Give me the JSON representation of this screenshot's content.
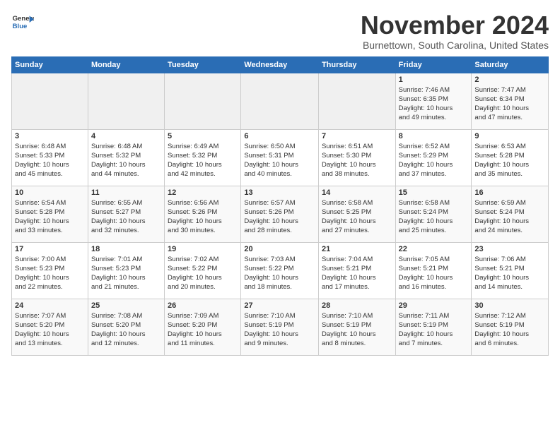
{
  "header": {
    "logo_general": "General",
    "logo_blue": "Blue",
    "month": "November 2024",
    "location": "Burnettown, South Carolina, United States"
  },
  "calendar": {
    "days_of_week": [
      "Sunday",
      "Monday",
      "Tuesday",
      "Wednesday",
      "Thursday",
      "Friday",
      "Saturday"
    ],
    "weeks": [
      [
        {
          "day": "",
          "info": ""
        },
        {
          "day": "",
          "info": ""
        },
        {
          "day": "",
          "info": ""
        },
        {
          "day": "",
          "info": ""
        },
        {
          "day": "",
          "info": ""
        },
        {
          "day": "1",
          "info": "Sunrise: 7:46 AM\nSunset: 6:35 PM\nDaylight: 10 hours\nand 49 minutes."
        },
        {
          "day": "2",
          "info": "Sunrise: 7:47 AM\nSunset: 6:34 PM\nDaylight: 10 hours\nand 47 minutes."
        }
      ],
      [
        {
          "day": "3",
          "info": "Sunrise: 6:48 AM\nSunset: 5:33 PM\nDaylight: 10 hours\nand 45 minutes."
        },
        {
          "day": "4",
          "info": "Sunrise: 6:48 AM\nSunset: 5:32 PM\nDaylight: 10 hours\nand 44 minutes."
        },
        {
          "day": "5",
          "info": "Sunrise: 6:49 AM\nSunset: 5:32 PM\nDaylight: 10 hours\nand 42 minutes."
        },
        {
          "day": "6",
          "info": "Sunrise: 6:50 AM\nSunset: 5:31 PM\nDaylight: 10 hours\nand 40 minutes."
        },
        {
          "day": "7",
          "info": "Sunrise: 6:51 AM\nSunset: 5:30 PM\nDaylight: 10 hours\nand 38 minutes."
        },
        {
          "day": "8",
          "info": "Sunrise: 6:52 AM\nSunset: 5:29 PM\nDaylight: 10 hours\nand 37 minutes."
        },
        {
          "day": "9",
          "info": "Sunrise: 6:53 AM\nSunset: 5:28 PM\nDaylight: 10 hours\nand 35 minutes."
        }
      ],
      [
        {
          "day": "10",
          "info": "Sunrise: 6:54 AM\nSunset: 5:28 PM\nDaylight: 10 hours\nand 33 minutes."
        },
        {
          "day": "11",
          "info": "Sunrise: 6:55 AM\nSunset: 5:27 PM\nDaylight: 10 hours\nand 32 minutes."
        },
        {
          "day": "12",
          "info": "Sunrise: 6:56 AM\nSunset: 5:26 PM\nDaylight: 10 hours\nand 30 minutes."
        },
        {
          "day": "13",
          "info": "Sunrise: 6:57 AM\nSunset: 5:26 PM\nDaylight: 10 hours\nand 28 minutes."
        },
        {
          "day": "14",
          "info": "Sunrise: 6:58 AM\nSunset: 5:25 PM\nDaylight: 10 hours\nand 27 minutes."
        },
        {
          "day": "15",
          "info": "Sunrise: 6:58 AM\nSunset: 5:24 PM\nDaylight: 10 hours\nand 25 minutes."
        },
        {
          "day": "16",
          "info": "Sunrise: 6:59 AM\nSunset: 5:24 PM\nDaylight: 10 hours\nand 24 minutes."
        }
      ],
      [
        {
          "day": "17",
          "info": "Sunrise: 7:00 AM\nSunset: 5:23 PM\nDaylight: 10 hours\nand 22 minutes."
        },
        {
          "day": "18",
          "info": "Sunrise: 7:01 AM\nSunset: 5:23 PM\nDaylight: 10 hours\nand 21 minutes."
        },
        {
          "day": "19",
          "info": "Sunrise: 7:02 AM\nSunset: 5:22 PM\nDaylight: 10 hours\nand 20 minutes."
        },
        {
          "day": "20",
          "info": "Sunrise: 7:03 AM\nSunset: 5:22 PM\nDaylight: 10 hours\nand 18 minutes."
        },
        {
          "day": "21",
          "info": "Sunrise: 7:04 AM\nSunset: 5:21 PM\nDaylight: 10 hours\nand 17 minutes."
        },
        {
          "day": "22",
          "info": "Sunrise: 7:05 AM\nSunset: 5:21 PM\nDaylight: 10 hours\nand 16 minutes."
        },
        {
          "day": "23",
          "info": "Sunrise: 7:06 AM\nSunset: 5:21 PM\nDaylight: 10 hours\nand 14 minutes."
        }
      ],
      [
        {
          "day": "24",
          "info": "Sunrise: 7:07 AM\nSunset: 5:20 PM\nDaylight: 10 hours\nand 13 minutes."
        },
        {
          "day": "25",
          "info": "Sunrise: 7:08 AM\nSunset: 5:20 PM\nDaylight: 10 hours\nand 12 minutes."
        },
        {
          "day": "26",
          "info": "Sunrise: 7:09 AM\nSunset: 5:20 PM\nDaylight: 10 hours\nand 11 minutes."
        },
        {
          "day": "27",
          "info": "Sunrise: 7:10 AM\nSunset: 5:19 PM\nDaylight: 10 hours\nand 9 minutes."
        },
        {
          "day": "28",
          "info": "Sunrise: 7:10 AM\nSunset: 5:19 PM\nDaylight: 10 hours\nand 8 minutes."
        },
        {
          "day": "29",
          "info": "Sunrise: 7:11 AM\nSunset: 5:19 PM\nDaylight: 10 hours\nand 7 minutes."
        },
        {
          "day": "30",
          "info": "Sunrise: 7:12 AM\nSunset: 5:19 PM\nDaylight: 10 hours\nand 6 minutes."
        }
      ]
    ]
  }
}
